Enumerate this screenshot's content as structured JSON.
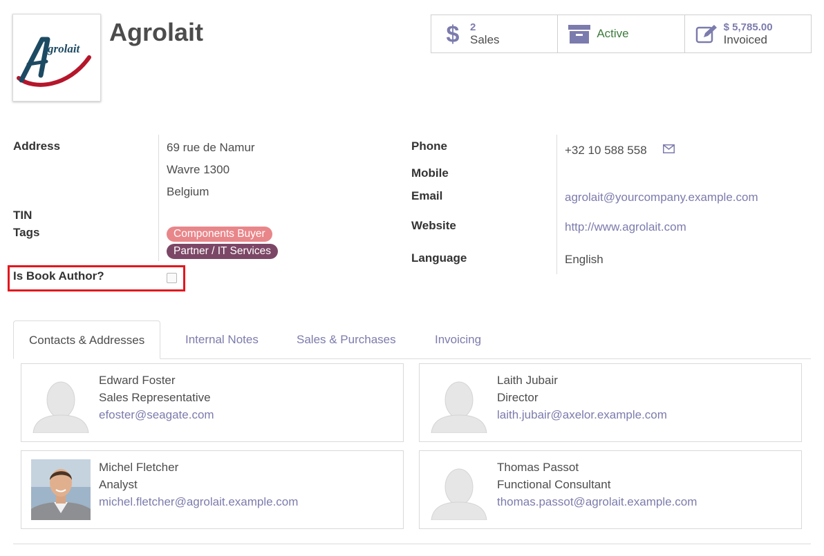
{
  "company": {
    "name": "Agrolait",
    "logo_text": "grolait"
  },
  "smart_buttons": {
    "sales": {
      "value": "2",
      "label": "Sales",
      "icon": "dollar-icon"
    },
    "active": {
      "label": "Active",
      "icon": "archive-icon"
    },
    "invoiced": {
      "value": "$ 5,785.00",
      "label": "Invoiced",
      "icon": "edit-icon"
    }
  },
  "fields": {
    "address_label": "Address",
    "address_line1": "69 rue de Namur",
    "address_line2": "Wavre 1300",
    "address_line3": "Belgium",
    "tin_label": "TIN",
    "tags_label": "Tags",
    "tags": [
      "Components Buyer",
      "Partner / IT Services"
    ],
    "book_author_label": "Is Book Author?",
    "book_author_checked": false,
    "phone_label": "Phone",
    "phone_value": "+32 10 588 558",
    "mobile_label": "Mobile",
    "email_label": "Email",
    "email_value": "agrolait@yourcompany.example.com",
    "website_label": "Website",
    "website_value": "http://www.agrolait.com",
    "language_label": "Language",
    "language_value": "English"
  },
  "tabs": [
    {
      "label": "Contacts & Addresses",
      "active": true
    },
    {
      "label": "Internal Notes",
      "active": false
    },
    {
      "label": "Sales & Purchases",
      "active": false
    },
    {
      "label": "Invoicing",
      "active": false
    }
  ],
  "contacts": [
    {
      "name": "Edward Foster",
      "role": "Sales Representative",
      "email": "efoster@seagate.com",
      "photo": "placeholder-avatar"
    },
    {
      "name": "Laith Jubair",
      "role": "Director",
      "email": "laith.jubair@axelor.example.com",
      "photo": "placeholder-avatar"
    },
    {
      "name": "Michel Fletcher",
      "role": "Analyst",
      "email": "michel.fletcher@agrolait.example.com",
      "photo": "person-photo"
    },
    {
      "name": "Thomas Passot",
      "role": "Functional Consultant",
      "email": "thomas.passot@agrolait.example.com",
      "photo": "placeholder-avatar"
    }
  ],
  "colors": {
    "accent": "#7c7bad",
    "active_green": "#3d7a3d",
    "tag_components": "#e8868a",
    "tag_partner": "#7c4766",
    "highlight_red": "#e3161d"
  }
}
